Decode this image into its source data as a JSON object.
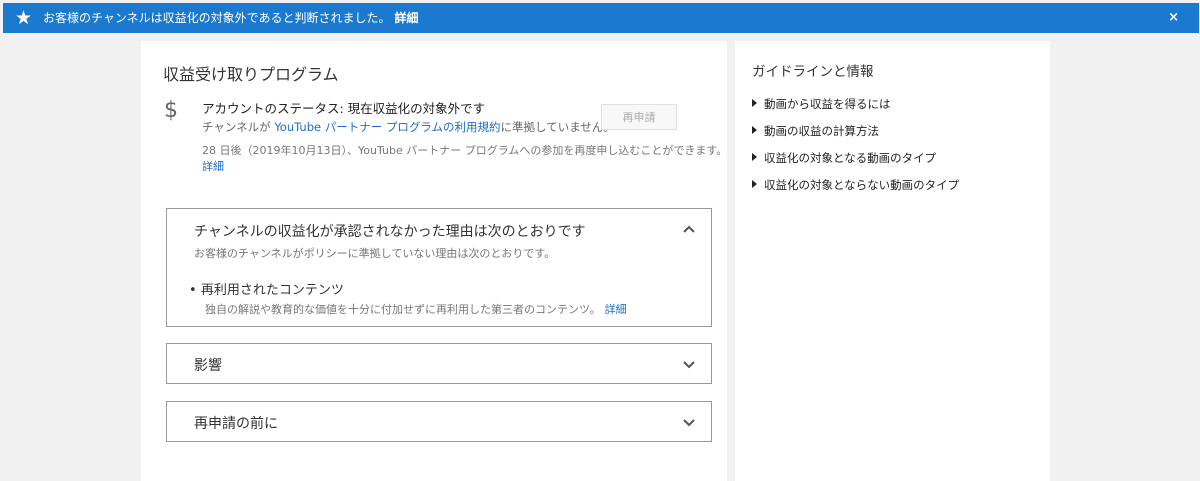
{
  "banner": {
    "message": "お客様のチャンネルは収益化の対象外であると判断されました。",
    "detail_link": "詳細",
    "close_label": "×",
    "bg_color": "#1b7ad0"
  },
  "main": {
    "title": "収益受け取りプログラム",
    "status_icon": "dollar-icon",
    "status_text": "アカウントのステータス: 現在収益化の対象外です",
    "policy_prefix": "チャンネルが ",
    "policy_link": "YouTube パートナー プログラムの利用規約",
    "policy_suffix": "に準拠していません。",
    "reapply_button": "再申請",
    "days_text": "28 日後（2019年10月13日）、YouTube パートナー プログラムへの参加を再度申し込むことができます。",
    "days_detail_link": "詳細",
    "sections": [
      {
        "title": "チャンネルの収益化が承認されなかった理由は次のとおりです",
        "subtitle": "お客様のチャンネルがポリシーに準拠していない理由は次のとおりです。",
        "reason_title": "再利用されたコンテンツ",
        "reason_desc": "独自の解説や教育的な価値を十分に付加せずに再利用した第三者のコンテンツ。",
        "reason_link": "詳細",
        "expanded": true
      },
      {
        "title": "影響",
        "expanded": false
      },
      {
        "title": "再申請の前に",
        "expanded": false
      }
    ]
  },
  "side": {
    "title": "ガイドラインと情報",
    "links": [
      "動画から収益を得るには",
      "動画の収益の計算方法",
      "収益化の対象となる動画のタイプ",
      "収益化の対象とならない動画のタイプ"
    ]
  },
  "colors": {
    "accent": "#1a6dcc",
    "page_bg": "#f1f1f1"
  }
}
